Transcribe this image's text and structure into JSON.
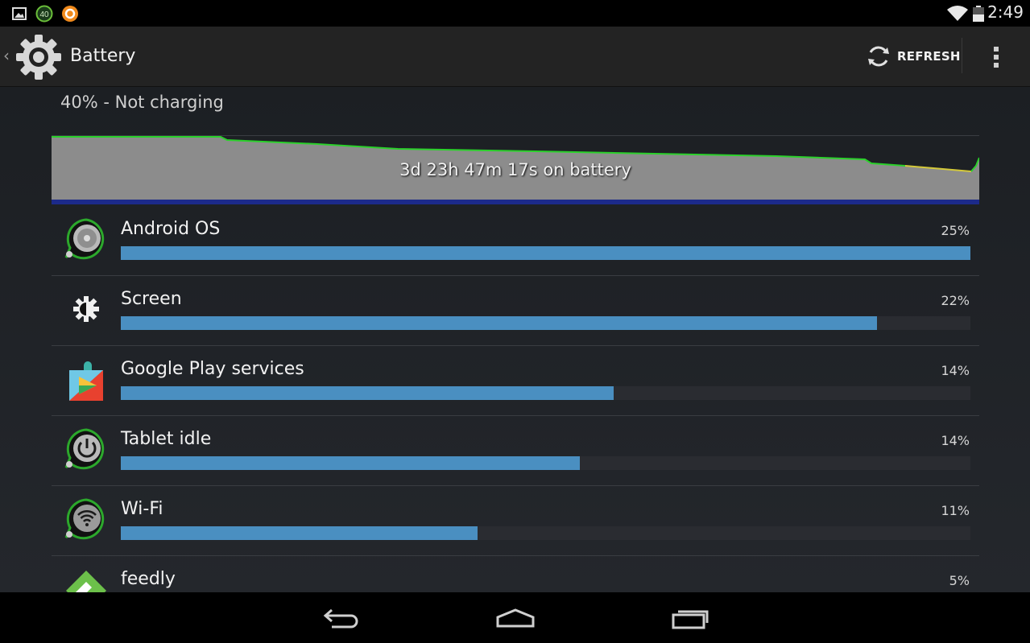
{
  "status_bar": {
    "time": "2:49",
    "notification_badge": "40",
    "icons": [
      "gallery-icon",
      "badge-40-icon",
      "orange-circle-icon",
      "wifi-icon",
      "battery-icon"
    ]
  },
  "action_bar": {
    "title": "Battery",
    "refresh_label": "REFRESH",
    "icons": [
      "back-chevron-icon",
      "settings-gear-icon",
      "refresh-icon",
      "overflow-menu-icon"
    ]
  },
  "battery": {
    "status": "40% - Not charging",
    "graph_label": "3d 23h 47m 17s on battery"
  },
  "usage": [
    {
      "name": "Android OS",
      "percent": "25%",
      "fill": 1.0,
      "icon": "android-os-icon"
    },
    {
      "name": "Screen",
      "percent": "22%",
      "fill": 0.89,
      "icon": "brightness-icon"
    },
    {
      "name": "Google Play services",
      "percent": "14%",
      "fill": 0.58,
      "icon": "play-services-icon"
    },
    {
      "name": "Tablet idle",
      "percent": "14%",
      "fill": 0.54,
      "icon": "power-icon"
    },
    {
      "name": "Wi-Fi",
      "percent": "11%",
      "fill": 0.42,
      "icon": "wifi-usage-icon"
    },
    {
      "name": "feedly",
      "percent": "5%",
      "fill": 0.19,
      "icon": "feedly-icon"
    }
  ],
  "colors": {
    "bar_fill": "#4a8fc1",
    "graph_fill": "#8c8c8c",
    "graph_line": "#2bd12b"
  },
  "navigation": {
    "icons": [
      "back-icon",
      "home-icon",
      "recents-icon"
    ]
  }
}
